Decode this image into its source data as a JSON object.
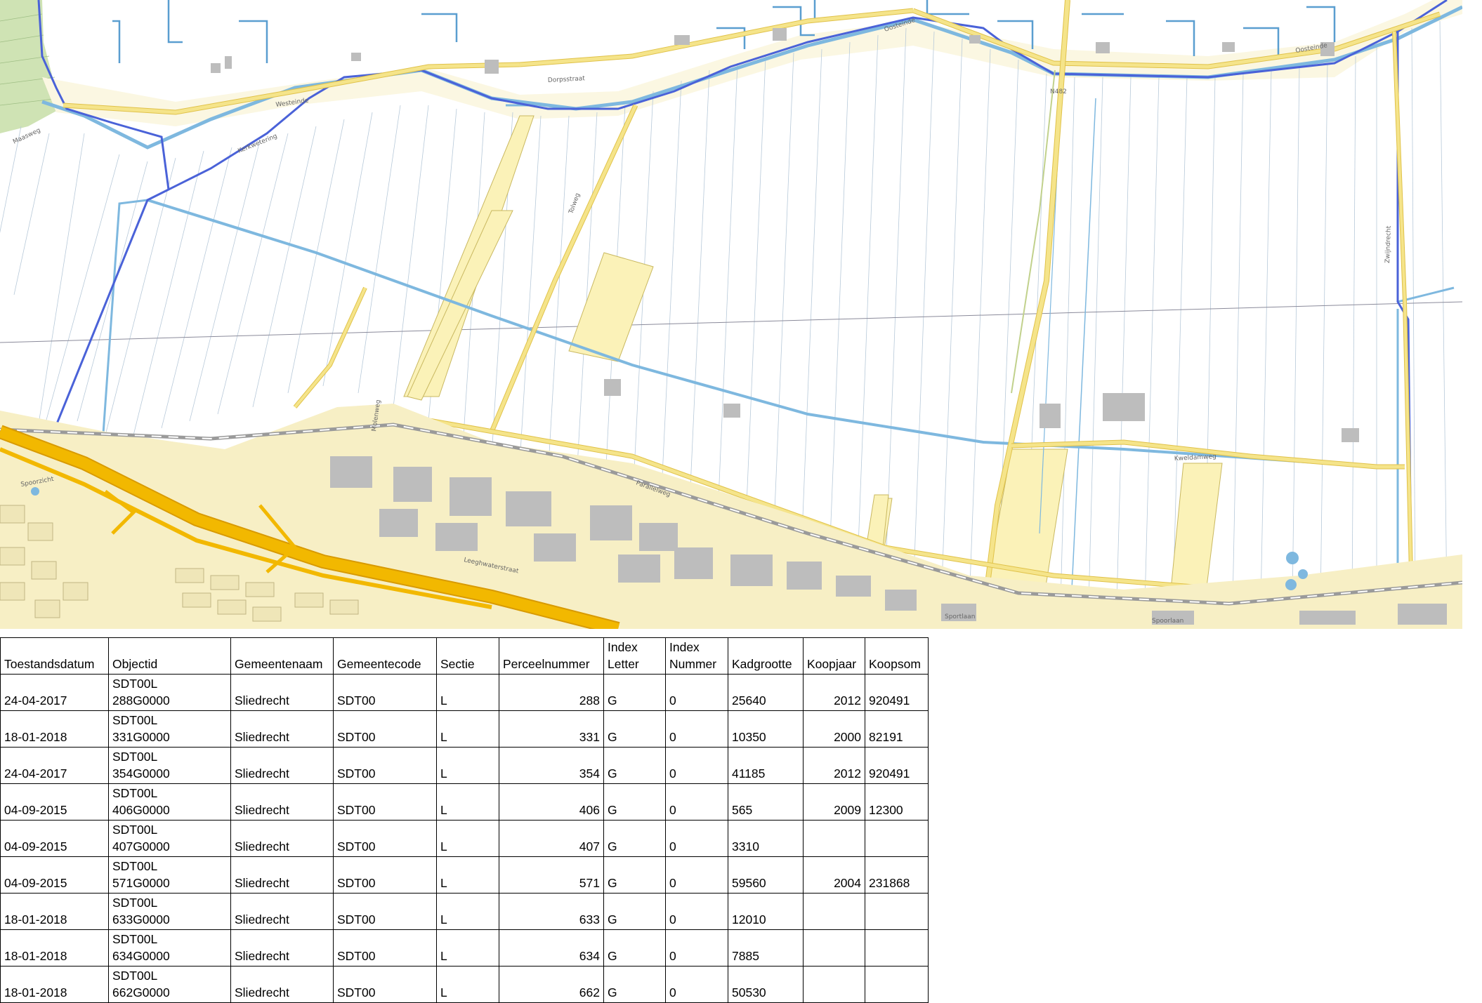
{
  "map": {
    "road_labels": {
      "westeinde": "Westeinde",
      "dorpsstraat": "Dorpsstraat",
      "oosteinde": "Oosteinde",
      "oosteinde_east": "Oosteinde",
      "n482": "N482",
      "tolweg": "Tolweg",
      "parallelweg": "Parallelweg",
      "kweldamweg": "Kweldamweg",
      "spoorlaan": "Spoorlaan",
      "leeghwaterstraat": "Leeghwaterstraat",
      "sportlaan": "Sportlaan",
      "zuidwijk": "Zwijndrecht",
      "molenweg": "Molenweg",
      "kerkweg": "Kerkwetering",
      "maasweg": "Maasweg",
      "spoorzicht": "Spoorzicht"
    },
    "colors": {
      "background": "#ffffff",
      "water": "#7eb8df",
      "water_dark": "#5a9ed0",
      "municipal_border": "#4a62d8",
      "highway": "#f2b800",
      "highway_edge": "#d89a00",
      "road_main": "#f5e48a",
      "road_edge": "#e0c24a",
      "parcel_highlight": "#fbf2b8",
      "parcel_line": "#b7c9d9",
      "built_area": "#f7efc5",
      "building": "#bdbdbd",
      "railway": "#9a9a9a",
      "grass": "#cfe3b4"
    }
  },
  "table": {
    "headers": {
      "toestandsdatum": "Toestandsdatum",
      "objectid": "Objectid",
      "gemeentenaam": "Gemeentenaam",
      "gemeentecode": "Gemeentecode",
      "sectie": "Sectie",
      "perceelnummer": "Perceelnummer",
      "index_letter": "Index Letter",
      "index_nummer": "Index Nummer",
      "kadgrootte": "Kadgrootte",
      "koopjaar": "Koopjaar",
      "koopsom": "Koopsom"
    },
    "rows": [
      {
        "toestandsdatum": "24-04-2017",
        "objectid_a": "SDT00L",
        "objectid_b": "288G0000",
        "gemeentenaam": "Sliedrecht",
        "gemeentecode": "SDT00",
        "sectie": "L",
        "perceelnummer": "288",
        "index_letter": "G",
        "index_nummer": "0",
        "kadgrootte": "25640",
        "koopjaar": "2012",
        "koopsom": "920491"
      },
      {
        "toestandsdatum": "18-01-2018",
        "objectid_a": "SDT00L",
        "objectid_b": "331G0000",
        "gemeentenaam": "Sliedrecht",
        "gemeentecode": "SDT00",
        "sectie": "L",
        "perceelnummer": "331",
        "index_letter": "G",
        "index_nummer": "0",
        "kadgrootte": "10350",
        "koopjaar": "2000",
        "koopsom": "82191"
      },
      {
        "toestandsdatum": "24-04-2017",
        "objectid_a": "SDT00L",
        "objectid_b": "354G0000",
        "gemeentenaam": "Sliedrecht",
        "gemeentecode": "SDT00",
        "sectie": "L",
        "perceelnummer": "354",
        "index_letter": "G",
        "index_nummer": "0",
        "kadgrootte": "41185",
        "koopjaar": "2012",
        "koopsom": "920491"
      },
      {
        "toestandsdatum": "04-09-2015",
        "objectid_a": "SDT00L",
        "objectid_b": "406G0000",
        "gemeentenaam": "Sliedrecht",
        "gemeentecode": "SDT00",
        "sectie": "L",
        "perceelnummer": "406",
        "index_letter": "G",
        "index_nummer": "0",
        "kadgrootte": "565",
        "koopjaar": "2009",
        "koopsom": "12300"
      },
      {
        "toestandsdatum": "04-09-2015",
        "objectid_a": "SDT00L",
        "objectid_b": "407G0000",
        "gemeentenaam": "Sliedrecht",
        "gemeentecode": "SDT00",
        "sectie": "L",
        "perceelnummer": "407",
        "index_letter": "G",
        "index_nummer": "0",
        "kadgrootte": "3310",
        "koopjaar": "",
        "koopsom": ""
      },
      {
        "toestandsdatum": "04-09-2015",
        "objectid_a": "SDT00L",
        "objectid_b": "571G0000",
        "gemeentenaam": "Sliedrecht",
        "gemeentecode": "SDT00",
        "sectie": "L",
        "perceelnummer": "571",
        "index_letter": "G",
        "index_nummer": "0",
        "kadgrootte": "59560",
        "koopjaar": "2004",
        "koopsom": "231868"
      },
      {
        "toestandsdatum": "18-01-2018",
        "objectid_a": "SDT00L",
        "objectid_b": "633G0000",
        "gemeentenaam": "Sliedrecht",
        "gemeentecode": "SDT00",
        "sectie": "L",
        "perceelnummer": "633",
        "index_letter": "G",
        "index_nummer": "0",
        "kadgrootte": "12010",
        "koopjaar": "",
        "koopsom": ""
      },
      {
        "toestandsdatum": "18-01-2018",
        "objectid_a": "SDT00L",
        "objectid_b": "634G0000",
        "gemeentenaam": "Sliedrecht",
        "gemeentecode": "SDT00",
        "sectie": "L",
        "perceelnummer": "634",
        "index_letter": "G",
        "index_nummer": "0",
        "kadgrootte": "7885",
        "koopjaar": "",
        "koopsom": ""
      },
      {
        "toestandsdatum": "18-01-2018",
        "objectid_a": "SDT00L",
        "objectid_b": "662G0000",
        "gemeentenaam": "Sliedrecht",
        "gemeentecode": "SDT00",
        "sectie": "L",
        "perceelnummer": "662",
        "index_letter": "G",
        "index_nummer": "0",
        "kadgrootte": "50530",
        "koopjaar": "",
        "koopsom": ""
      }
    ]
  }
}
